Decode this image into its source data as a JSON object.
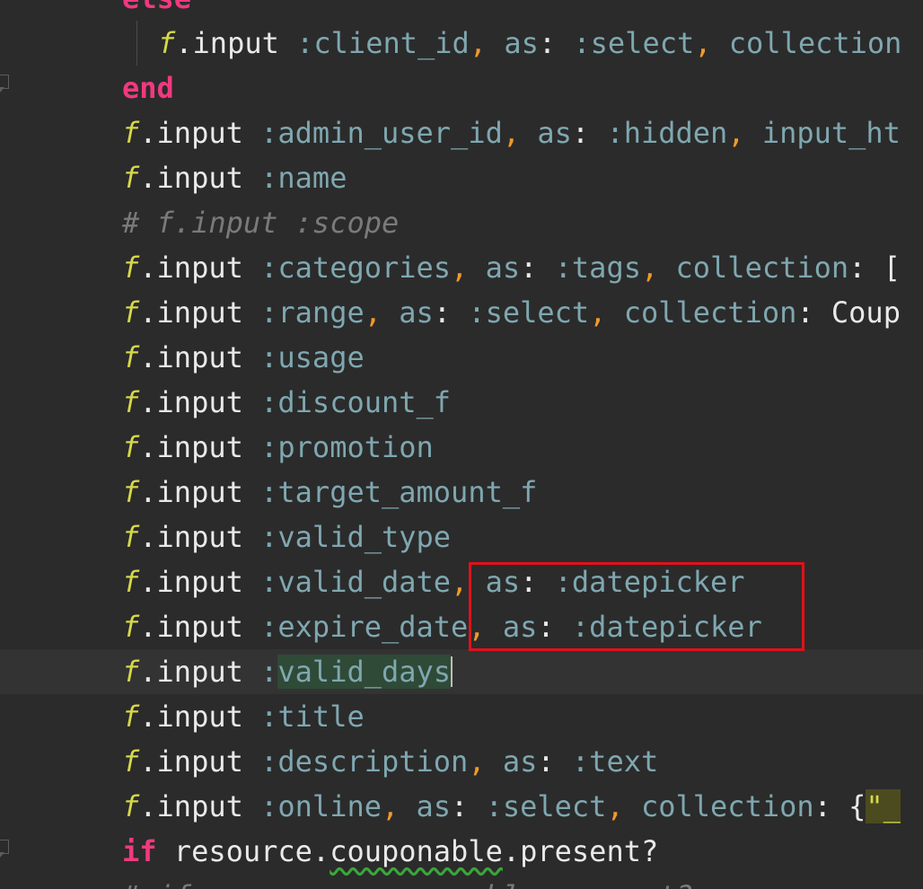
{
  "editor": {
    "lines": [
      {
        "segments": [
          {
            "c": "kw",
            "t": "else"
          }
        ]
      },
      {
        "segments": [
          {
            "c": "var",
            "t": "f"
          },
          {
            "c": "def",
            "t": ".input "
          },
          {
            "c": "sym",
            "t": ":client_id"
          },
          {
            "c": "pun",
            "t": ", "
          },
          {
            "c": "sym",
            "t": "as"
          },
          {
            "c": "def",
            "t": ": "
          },
          {
            "c": "sym",
            "t": ":select"
          },
          {
            "c": "pun",
            "t": ", "
          },
          {
            "c": "sym",
            "t": "collection"
          }
        ]
      },
      {
        "segments": [
          {
            "c": "kw",
            "t": "end"
          }
        ]
      },
      {
        "segments": [
          {
            "c": "var",
            "t": "f"
          },
          {
            "c": "def",
            "t": ".input "
          },
          {
            "c": "sym",
            "t": ":admin_user_id"
          },
          {
            "c": "pun",
            "t": ", "
          },
          {
            "c": "sym",
            "t": "as"
          },
          {
            "c": "def",
            "t": ": "
          },
          {
            "c": "sym",
            "t": ":hidden"
          },
          {
            "c": "pun",
            "t": ", "
          },
          {
            "c": "sym",
            "t": "input_ht"
          }
        ]
      },
      {
        "segments": [
          {
            "c": "var",
            "t": "f"
          },
          {
            "c": "def",
            "t": ".input "
          },
          {
            "c": "sym",
            "t": ":name"
          }
        ]
      },
      {
        "segments": [
          {
            "c": "com",
            "t": "# f.input :scope"
          }
        ]
      },
      {
        "segments": [
          {
            "c": "var",
            "t": "f"
          },
          {
            "c": "def",
            "t": ".input "
          },
          {
            "c": "sym",
            "t": ":categories"
          },
          {
            "c": "pun",
            "t": ", "
          },
          {
            "c": "sym",
            "t": "as"
          },
          {
            "c": "def",
            "t": ": "
          },
          {
            "c": "sym",
            "t": ":tags"
          },
          {
            "c": "pun",
            "t": ", "
          },
          {
            "c": "sym",
            "t": "collection"
          },
          {
            "c": "def",
            "t": ": ["
          }
        ]
      },
      {
        "segments": [
          {
            "c": "var",
            "t": "f"
          },
          {
            "c": "def",
            "t": ".input "
          },
          {
            "c": "sym",
            "t": ":range"
          },
          {
            "c": "pun",
            "t": ", "
          },
          {
            "c": "sym",
            "t": "as"
          },
          {
            "c": "def",
            "t": ": "
          },
          {
            "c": "sym",
            "t": ":select"
          },
          {
            "c": "pun",
            "t": ", "
          },
          {
            "c": "sym",
            "t": "collection"
          },
          {
            "c": "def",
            "t": ": Coup"
          }
        ]
      },
      {
        "segments": [
          {
            "c": "var",
            "t": "f"
          },
          {
            "c": "def",
            "t": ".input "
          },
          {
            "c": "sym",
            "t": ":usage"
          }
        ]
      },
      {
        "segments": [
          {
            "c": "var",
            "t": "f"
          },
          {
            "c": "def",
            "t": ".input "
          },
          {
            "c": "sym",
            "t": ":discount_f"
          }
        ]
      },
      {
        "segments": [
          {
            "c": "var",
            "t": "f"
          },
          {
            "c": "def",
            "t": ".input "
          },
          {
            "c": "sym",
            "t": ":promotion"
          }
        ]
      },
      {
        "segments": [
          {
            "c": "var",
            "t": "f"
          },
          {
            "c": "def",
            "t": ".input "
          },
          {
            "c": "sym",
            "t": ":target_amount_f"
          }
        ]
      },
      {
        "segments": [
          {
            "c": "var",
            "t": "f"
          },
          {
            "c": "def",
            "t": ".input "
          },
          {
            "c": "sym",
            "t": ":valid_type"
          }
        ]
      },
      {
        "segments": [
          {
            "c": "var",
            "t": "f"
          },
          {
            "c": "def",
            "t": ".input "
          },
          {
            "c": "sym",
            "t": ":valid_date"
          },
          {
            "c": "pun",
            "t": ", "
          },
          {
            "c": "sym",
            "t": "as"
          },
          {
            "c": "def",
            "t": ": "
          },
          {
            "c": "sym",
            "t": ":datepicker"
          }
        ]
      },
      {
        "segments": [
          {
            "c": "var",
            "t": "f"
          },
          {
            "c": "def",
            "t": ".input "
          },
          {
            "c": "sym",
            "t": ":expire_date"
          },
          {
            "c": "pun",
            "t": ", "
          },
          {
            "c": "sym",
            "t": "as"
          },
          {
            "c": "def",
            "t": ": "
          },
          {
            "c": "sym",
            "t": ":datepicker"
          }
        ]
      },
      {
        "segments": [
          {
            "c": "var",
            "t": "f"
          },
          {
            "c": "def",
            "t": ".input "
          },
          {
            "c": "sym",
            "t": ":"
          },
          {
            "c": "sym sel",
            "t": "valid_days"
          },
          {
            "c": "caret",
            "t": ""
          }
        ]
      },
      {
        "segments": [
          {
            "c": "var",
            "t": "f"
          },
          {
            "c": "def",
            "t": ".input "
          },
          {
            "c": "sym",
            "t": ":title"
          }
        ]
      },
      {
        "segments": [
          {
            "c": "var",
            "t": "f"
          },
          {
            "c": "def",
            "t": ".input "
          },
          {
            "c": "sym",
            "t": ":description"
          },
          {
            "c": "pun",
            "t": ", "
          },
          {
            "c": "sym",
            "t": "as"
          },
          {
            "c": "def",
            "t": ": "
          },
          {
            "c": "sym",
            "t": ":text"
          }
        ]
      },
      {
        "segments": [
          {
            "c": "var",
            "t": "f"
          },
          {
            "c": "def",
            "t": ".input "
          },
          {
            "c": "sym",
            "t": ":online"
          },
          {
            "c": "pun",
            "t": ", "
          },
          {
            "c": "sym",
            "t": "as"
          },
          {
            "c": "def",
            "t": ": "
          },
          {
            "c": "sym",
            "t": ":select"
          },
          {
            "c": "pun",
            "t": ", "
          },
          {
            "c": "sym",
            "t": "collection"
          },
          {
            "c": "def",
            "t": ": {"
          },
          {
            "c": "str",
            "t": "\"_"
          }
        ]
      },
      {
        "segments": [
          {
            "c": "kw",
            "t": "if"
          },
          {
            "c": "def",
            "t": " resource."
          },
          {
            "c": "def squig",
            "t": "couponable"
          },
          {
            "c": "def",
            "t": ".present?"
          }
        ]
      },
      {
        "segments": [
          {
            "c": "com",
            "t": "# if resource.couponable.present?"
          }
        ]
      }
    ]
  }
}
